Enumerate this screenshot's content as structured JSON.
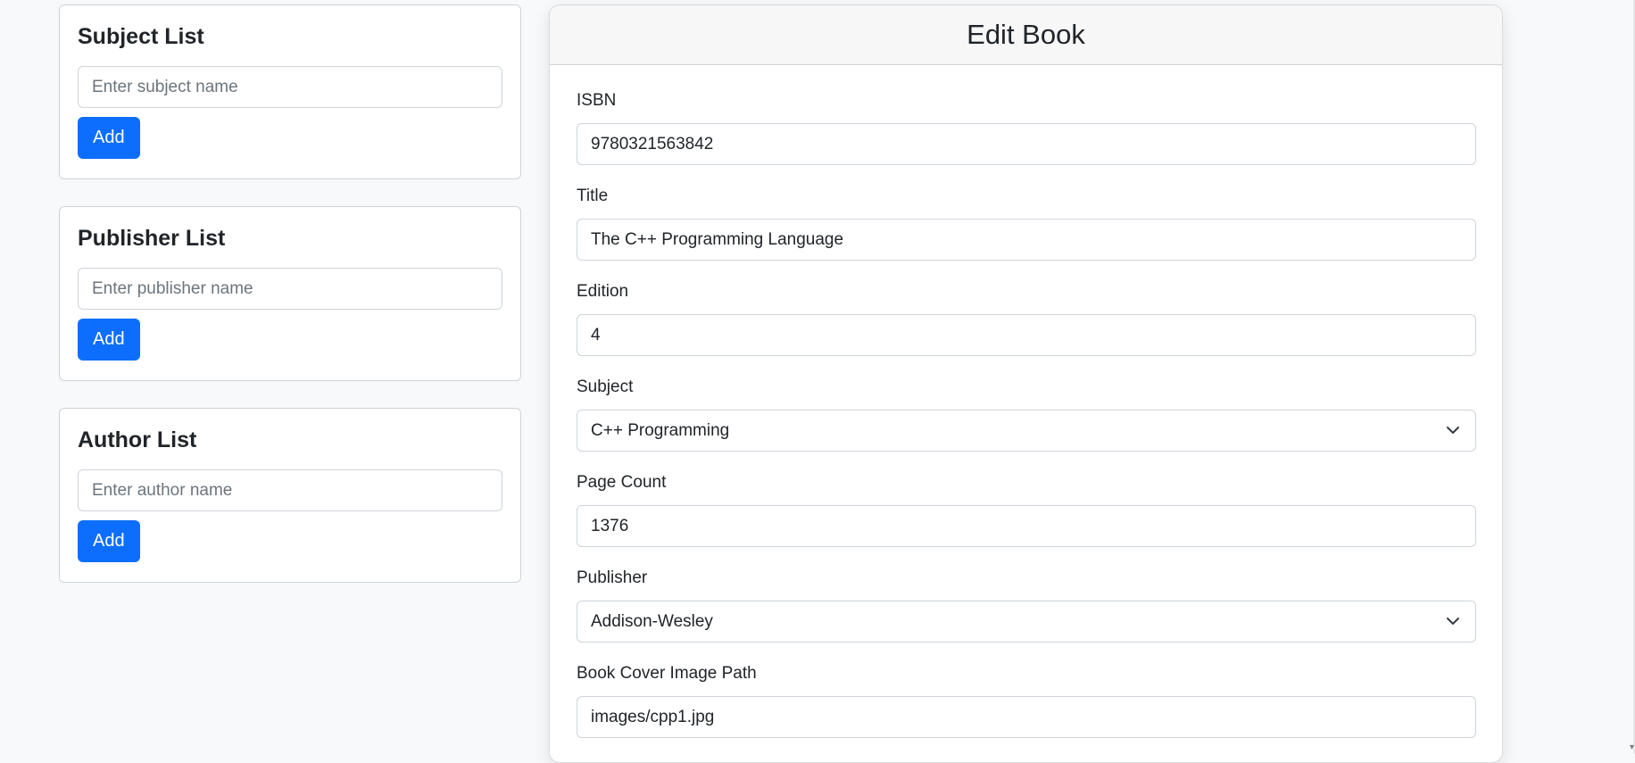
{
  "subject_card": {
    "title": "Subject List",
    "input_placeholder": "Enter subject name",
    "button_label": "Add"
  },
  "publisher_card": {
    "title": "Publisher List",
    "input_placeholder": "Enter publisher name",
    "button_label": "Add"
  },
  "author_card": {
    "title": "Author List",
    "input_placeholder": "Enter author name",
    "button_label": "Add"
  },
  "edit_book": {
    "title": "Edit Book",
    "fields": {
      "isbn": {
        "label": "ISBN",
        "value": "9780321563842"
      },
      "title": {
        "label": "Title",
        "value": "The C++ Programming Language"
      },
      "edition": {
        "label": "Edition",
        "value": "4"
      },
      "subject": {
        "label": "Subject",
        "selected": "C++ Programming"
      },
      "page_count": {
        "label": "Page Count",
        "value": "1376"
      },
      "publisher": {
        "label": "Publisher",
        "selected": "Addison-Wesley"
      },
      "cover_path": {
        "label": "Book Cover Image Path",
        "value": "images/cpp1.jpg"
      }
    }
  },
  "colors": {
    "page_background": "#f8f9fa",
    "primary_button": "#0d6efd",
    "border": "#ced4da"
  },
  "icons": {
    "select_arrow": "chevron-down-icon"
  }
}
